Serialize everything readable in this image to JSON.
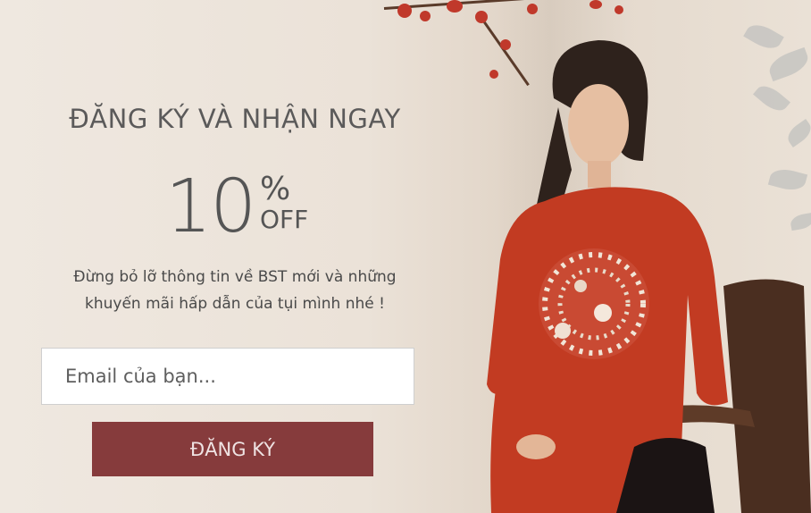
{
  "popup": {
    "title": "ĐĂNG KÝ VÀ NHẬN NGAY",
    "discount_number": "10",
    "discount_percent": "%",
    "discount_off": "OFF",
    "description_line1": "Đừng bỏ lỡ thông tin về BST mới và những",
    "description_line2": "khuyến mãi hấp dẫn của tụi mình nhé !",
    "email_placeholder": "Email của bạn...",
    "submit_label": "ĐĂNG KÝ"
  },
  "colors": {
    "button_bg": "#863b3c",
    "dress_red": "#c23b22",
    "text_grey": "#555555"
  }
}
